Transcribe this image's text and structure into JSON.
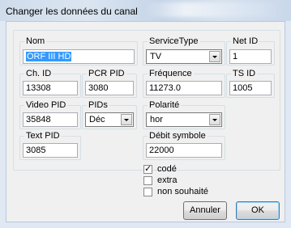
{
  "window": {
    "title": "Changer les données du canal"
  },
  "fields": {
    "nom": {
      "label": "Nom",
      "value": "ORF III HD"
    },
    "service_type": {
      "label": "ServiceType",
      "value": "TV"
    },
    "net_id": {
      "label": "Net ID",
      "value": "1"
    },
    "ch_id": {
      "label": "Ch. ID",
      "value": "13308"
    },
    "pcr_pid": {
      "label": "PCR PID",
      "value": "3080"
    },
    "frequence": {
      "label": "Fréquence",
      "value": "11273.0"
    },
    "ts_id": {
      "label": "TS ID",
      "value": "1005"
    },
    "video_pid": {
      "label": "Video PID",
      "value": "35848"
    },
    "pids": {
      "label": "PIDs",
      "value": "Déc"
    },
    "polarite": {
      "label": "Polarité",
      "value": "hor"
    },
    "text_pid": {
      "label": "Text PID",
      "value": "3085"
    },
    "debit_symbole": {
      "label": "Débit symbole",
      "value": "22000"
    }
  },
  "checkboxes": [
    {
      "label": "codé",
      "checked": true
    },
    {
      "label": "extra",
      "checked": false
    },
    {
      "label": "non souhaité",
      "checked": false
    }
  ],
  "buttons": {
    "cancel": "Annuler",
    "ok": "OK"
  },
  "colors": {
    "selection": "#3399ff",
    "window_frame": "#dfe8f3",
    "dialog_bg": "#f0f0f0"
  }
}
